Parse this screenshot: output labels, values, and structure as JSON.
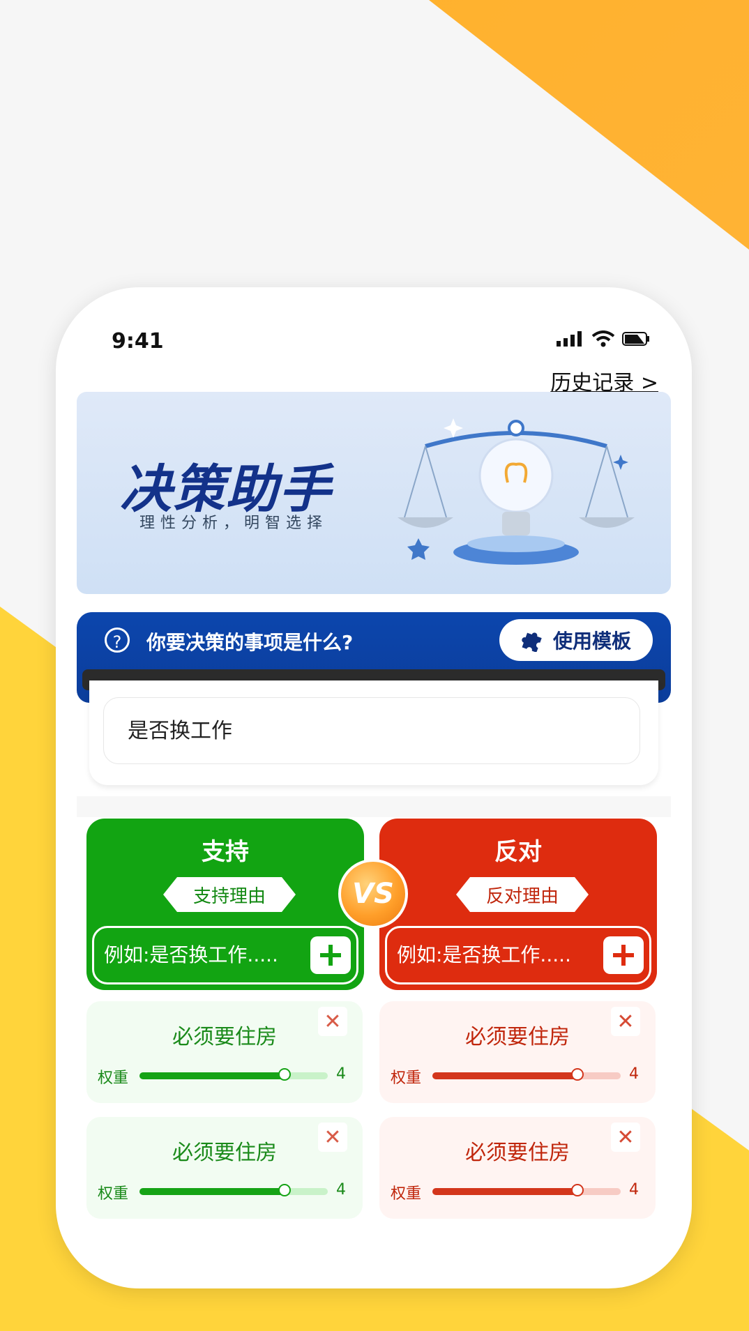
{
  "status_bar": {
    "time": "9:41"
  },
  "header": {
    "history_link": "历史记录 >"
  },
  "banner": {
    "title": "决策助手",
    "subtitle": "理性分析，明智选择"
  },
  "question": {
    "prompt": "你要决策的事项是什么?",
    "template_button": "使用模板",
    "value": "是否换工作"
  },
  "columns": {
    "support": {
      "title": "支持",
      "tag": "支持理由",
      "placeholder": "例如:是否换工作.....",
      "color": "#12a412"
    },
    "oppose": {
      "title": "反对",
      "tag": "反对理由",
      "placeholder": "例如:是否换工作.....",
      "color": "#de2c0f"
    },
    "vs_label": "VS"
  },
  "support_items": [
    {
      "title": "必须要住房",
      "weight_label": "权重",
      "weight": 4,
      "weight_fraction": 0.77
    },
    {
      "title": "必须要住房",
      "weight_label": "权重",
      "weight": 4,
      "weight_fraction": 0.77
    }
  ],
  "oppose_items": [
    {
      "title": "必须要住房",
      "weight_label": "权重",
      "weight": 4,
      "weight_fraction": 0.77
    },
    {
      "title": "必须要住房",
      "weight_label": "权重",
      "weight": 4,
      "weight_fraction": 0.77
    }
  ],
  "icons": {
    "close": "close-icon",
    "add": "plus-icon",
    "help": "question-circle-icon",
    "puzzle": "puzzle-icon"
  }
}
